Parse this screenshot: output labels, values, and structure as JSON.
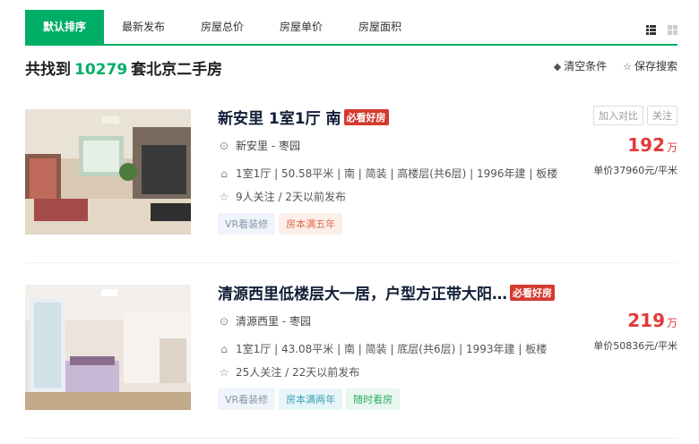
{
  "tabs": [
    {
      "label": "默认排序",
      "active": true
    },
    {
      "label": "最新发布",
      "active": false
    },
    {
      "label": "房屋总价",
      "active": false
    },
    {
      "label": "房屋单价",
      "active": false
    },
    {
      "label": "房屋面积",
      "active": false
    }
  ],
  "summary": {
    "prefix": "共找到",
    "count": "10279",
    "suffix": "套北京二手房"
  },
  "actions": {
    "clear": "清空条件",
    "save": "保存搜索"
  },
  "listings": [
    {
      "title": "新安里 1室1厅 南",
      "badge": "必看好房",
      "community": "新安里",
      "district": "枣园",
      "details": "1室1厅 | 50.58平米 | 南 | 简装 | 高楼层(共6层) | 1996年建 | 板楼",
      "follow": "9人关注 / 2天以前发布",
      "tags": [
        "VR看装修",
        "房本满五年"
      ],
      "price": "192",
      "price_unit": "万",
      "unit_price": "单价37960元/平米",
      "compare_label": "加入对比",
      "follow_label": "关注"
    },
    {
      "title": "清源西里低楼层大一居，户型方正带大阳…",
      "badge": "必看好房",
      "community": "清源西里",
      "district": "枣园",
      "details": "1室1厅 | 43.08平米 | 南 | 简装 | 底层(共6层) | 1993年建 | 板楼",
      "follow": "25人关注 / 22天以前发布",
      "tags": [
        "VR看装修",
        "房本满两年",
        "随时看房"
      ],
      "price": "219",
      "price_unit": "万",
      "unit_price": "单价50836元/平米"
    }
  ],
  "separator": " - ",
  "colors": {
    "brand": "#00ae66",
    "price": "#e4393c",
    "badge": "#d43a2f"
  },
  "icons": [
    "list-view-icon",
    "grid-view-icon",
    "eraser-icon",
    "star-icon",
    "location-icon",
    "house-icon"
  ]
}
